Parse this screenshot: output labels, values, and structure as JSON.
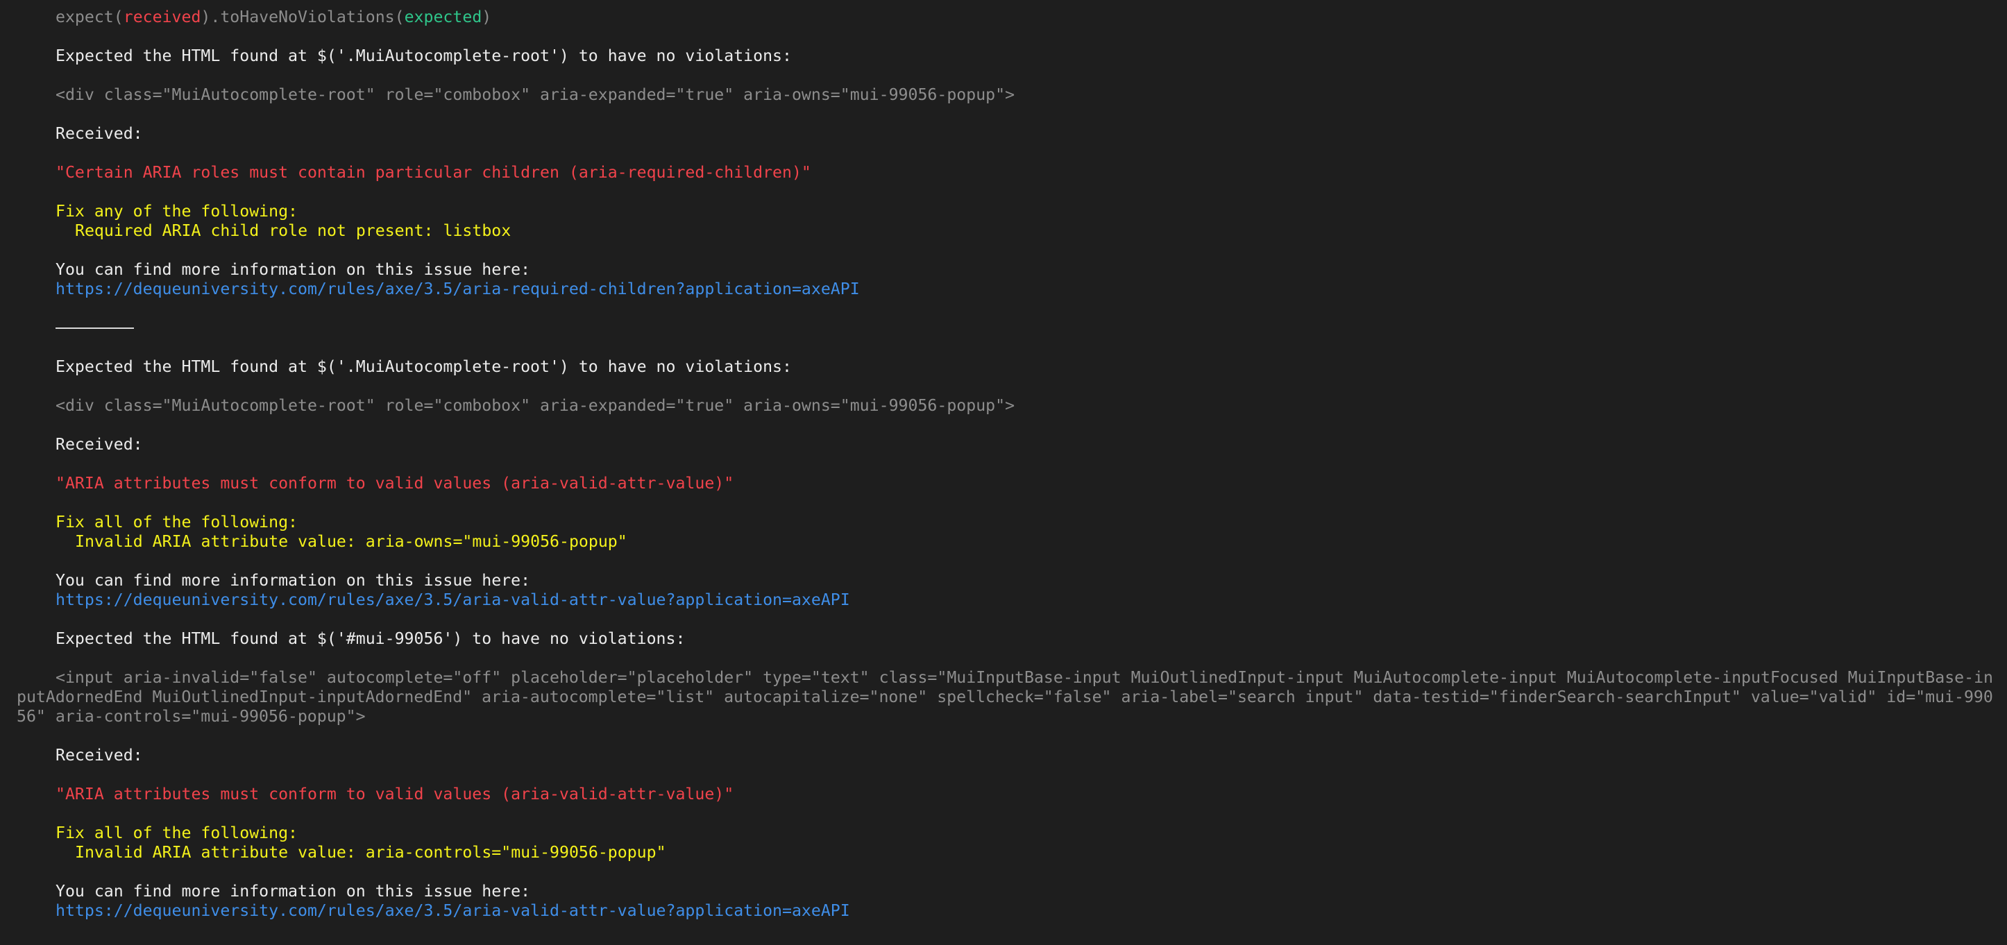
{
  "header": {
    "expect_prefix": "expect(",
    "received_word": "received",
    "matcher": ").toHaveNoViolations(",
    "expected_word": "expected",
    "close_paren": ")"
  },
  "blocks": [
    {
      "expected_line": "Expected the HTML found at $('.MuiAutocomplete-root') to have no violations:",
      "html_snippet": "<div class=\"MuiAutocomplete-root\" role=\"combobox\" aria-expanded=\"true\" aria-owns=\"mui-99056-popup\">",
      "received_label": "Received:",
      "violation": "\"Certain ARIA roles must contain particular children (aria-required-children)\"",
      "fix_heading": "Fix any of the following:",
      "fix_detail": "Required ARIA child role not present: listbox",
      "info_text": "You can find more information on this issue here:",
      "info_link": "https://dequeuniversity.com/rules/axe/3.5/aria-required-children?application=axeAPI"
    },
    {
      "expected_line": "Expected the HTML found at $('.MuiAutocomplete-root') to have no violations:",
      "html_snippet": "<div class=\"MuiAutocomplete-root\" role=\"combobox\" aria-expanded=\"true\" aria-owns=\"mui-99056-popup\">",
      "received_label": "Received:",
      "violation": "\"ARIA attributes must conform to valid values (aria-valid-attr-value)\"",
      "fix_heading": "Fix all of the following:",
      "fix_detail": "Invalid ARIA attribute value: aria-owns=\"mui-99056-popup\"",
      "info_text": "You can find more information on this issue here:",
      "info_link": "https://dequeuniversity.com/rules/axe/3.5/aria-valid-attr-value?application=axeAPI"
    },
    {
      "expected_line": "Expected the HTML found at $('#mui-99056') to have no violations:",
      "html_snippet_lines": [
        "<input aria-invalid=\"false\" autocomplete=\"off\" placeholder=\"placeholder\" type=\"text\" class=\"MuiInputBase-input MuiOutlinedInput-input MuiAutocomplete-input MuiAutocomplete-inputFocused MuiInputBase-in",
        "putAdornedEnd MuiOutlinedInput-inputAdornedEnd\" aria-autocomplete=\"list\" autocapitalize=\"none\" spellcheck=\"false\" aria-label=\"search input\" data-testid=\"finderSearch-searchInput\" value=\"valid\" id=\"mui-990",
        "56\" aria-controls=\"mui-99056-popup\">"
      ],
      "received_label": "Received:",
      "violation": "\"ARIA attributes must conform to valid values (aria-valid-attr-value)\"",
      "fix_heading": "Fix all of the following:",
      "fix_detail": "Invalid ARIA attribute value: aria-controls=\"mui-99056-popup\"",
      "info_text": "You can find more information on this issue here:",
      "info_link": "https://dequeuniversity.com/rules/axe/3.5/aria-valid-attr-value?application=axeAPI"
    }
  ],
  "colors": {
    "background": "#1e1e1e",
    "text": "#ececec",
    "muted": "#8d8d8d",
    "error": "#f0434b",
    "success": "#2fc58a",
    "warning": "#f4f21b",
    "link": "#3f8ee8"
  }
}
